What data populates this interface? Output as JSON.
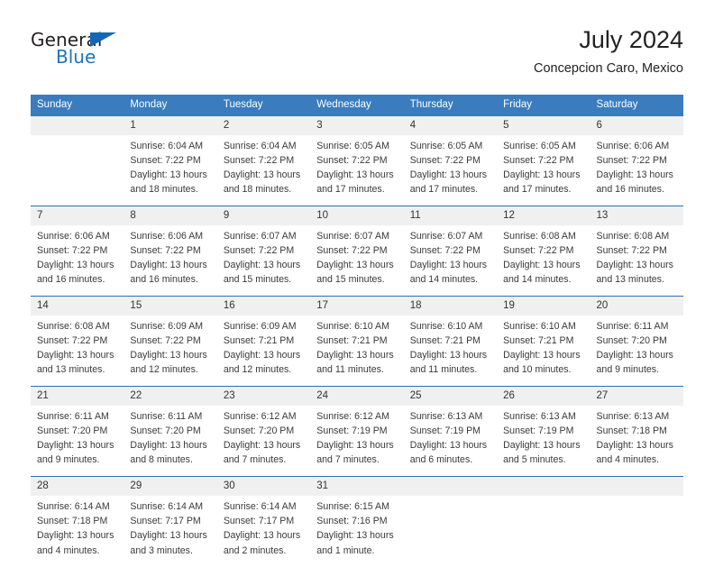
{
  "brand": {
    "name_part1": "General",
    "name_part2": "Blue",
    "triangle_icon": "triangle-icon",
    "color_black": "#231f20",
    "color_blue": "#1b75bb"
  },
  "header": {
    "title": "July 2024",
    "subtitle": "Concepcion Caro, Mexico"
  },
  "theme": {
    "header_bg": "#3a7cbe",
    "header_text": "#ffffff",
    "daynum_bg": "#f0f0f0",
    "week_divider": "#2f6fb0",
    "body_text": "#3a3a3a"
  },
  "weekday_headers": [
    "Sunday",
    "Monday",
    "Tuesday",
    "Wednesday",
    "Thursday",
    "Friday",
    "Saturday"
  ],
  "weeks": [
    {
      "days": [
        {
          "num": "",
          "sunrise": "",
          "sunset": "",
          "daylight": "",
          "empty": true
        },
        {
          "num": "1",
          "sunrise": "Sunrise: 6:04 AM",
          "sunset": "Sunset: 7:22 PM",
          "daylight": "Daylight: 13 hours and 18 minutes."
        },
        {
          "num": "2",
          "sunrise": "Sunrise: 6:04 AM",
          "sunset": "Sunset: 7:22 PM",
          "daylight": "Daylight: 13 hours and 18 minutes."
        },
        {
          "num": "3",
          "sunrise": "Sunrise: 6:05 AM",
          "sunset": "Sunset: 7:22 PM",
          "daylight": "Daylight: 13 hours and 17 minutes."
        },
        {
          "num": "4",
          "sunrise": "Sunrise: 6:05 AM",
          "sunset": "Sunset: 7:22 PM",
          "daylight": "Daylight: 13 hours and 17 minutes."
        },
        {
          "num": "5",
          "sunrise": "Sunrise: 6:05 AM",
          "sunset": "Sunset: 7:22 PM",
          "daylight": "Daylight: 13 hours and 17 minutes."
        },
        {
          "num": "6",
          "sunrise": "Sunrise: 6:06 AM",
          "sunset": "Sunset: 7:22 PM",
          "daylight": "Daylight: 13 hours and 16 minutes."
        }
      ]
    },
    {
      "days": [
        {
          "num": "7",
          "sunrise": "Sunrise: 6:06 AM",
          "sunset": "Sunset: 7:22 PM",
          "daylight": "Daylight: 13 hours and 16 minutes."
        },
        {
          "num": "8",
          "sunrise": "Sunrise: 6:06 AM",
          "sunset": "Sunset: 7:22 PM",
          "daylight": "Daylight: 13 hours and 16 minutes."
        },
        {
          "num": "9",
          "sunrise": "Sunrise: 6:07 AM",
          "sunset": "Sunset: 7:22 PM",
          "daylight": "Daylight: 13 hours and 15 minutes."
        },
        {
          "num": "10",
          "sunrise": "Sunrise: 6:07 AM",
          "sunset": "Sunset: 7:22 PM",
          "daylight": "Daylight: 13 hours and 15 minutes."
        },
        {
          "num": "11",
          "sunrise": "Sunrise: 6:07 AM",
          "sunset": "Sunset: 7:22 PM",
          "daylight": "Daylight: 13 hours and 14 minutes."
        },
        {
          "num": "12",
          "sunrise": "Sunrise: 6:08 AM",
          "sunset": "Sunset: 7:22 PM",
          "daylight": "Daylight: 13 hours and 14 minutes."
        },
        {
          "num": "13",
          "sunrise": "Sunrise: 6:08 AM",
          "sunset": "Sunset: 7:22 PM",
          "daylight": "Daylight: 13 hours and 13 minutes."
        }
      ]
    },
    {
      "days": [
        {
          "num": "14",
          "sunrise": "Sunrise: 6:08 AM",
          "sunset": "Sunset: 7:22 PM",
          "daylight": "Daylight: 13 hours and 13 minutes."
        },
        {
          "num": "15",
          "sunrise": "Sunrise: 6:09 AM",
          "sunset": "Sunset: 7:22 PM",
          "daylight": "Daylight: 13 hours and 12 minutes."
        },
        {
          "num": "16",
          "sunrise": "Sunrise: 6:09 AM",
          "sunset": "Sunset: 7:21 PM",
          "daylight": "Daylight: 13 hours and 12 minutes."
        },
        {
          "num": "17",
          "sunrise": "Sunrise: 6:10 AM",
          "sunset": "Sunset: 7:21 PM",
          "daylight": "Daylight: 13 hours and 11 minutes."
        },
        {
          "num": "18",
          "sunrise": "Sunrise: 6:10 AM",
          "sunset": "Sunset: 7:21 PM",
          "daylight": "Daylight: 13 hours and 11 minutes."
        },
        {
          "num": "19",
          "sunrise": "Sunrise: 6:10 AM",
          "sunset": "Sunset: 7:21 PM",
          "daylight": "Daylight: 13 hours and 10 minutes."
        },
        {
          "num": "20",
          "sunrise": "Sunrise: 6:11 AM",
          "sunset": "Sunset: 7:20 PM",
          "daylight": "Daylight: 13 hours and 9 minutes."
        }
      ]
    },
    {
      "days": [
        {
          "num": "21",
          "sunrise": "Sunrise: 6:11 AM",
          "sunset": "Sunset: 7:20 PM",
          "daylight": "Daylight: 13 hours and 9 minutes."
        },
        {
          "num": "22",
          "sunrise": "Sunrise: 6:11 AM",
          "sunset": "Sunset: 7:20 PM",
          "daylight": "Daylight: 13 hours and 8 minutes."
        },
        {
          "num": "23",
          "sunrise": "Sunrise: 6:12 AM",
          "sunset": "Sunset: 7:20 PM",
          "daylight": "Daylight: 13 hours and 7 minutes."
        },
        {
          "num": "24",
          "sunrise": "Sunrise: 6:12 AM",
          "sunset": "Sunset: 7:19 PM",
          "daylight": "Daylight: 13 hours and 7 minutes."
        },
        {
          "num": "25",
          "sunrise": "Sunrise: 6:13 AM",
          "sunset": "Sunset: 7:19 PM",
          "daylight": "Daylight: 13 hours and 6 minutes."
        },
        {
          "num": "26",
          "sunrise": "Sunrise: 6:13 AM",
          "sunset": "Sunset: 7:19 PM",
          "daylight": "Daylight: 13 hours and 5 minutes."
        },
        {
          "num": "27",
          "sunrise": "Sunrise: 6:13 AM",
          "sunset": "Sunset: 7:18 PM",
          "daylight": "Daylight: 13 hours and 4 minutes."
        }
      ]
    },
    {
      "days": [
        {
          "num": "28",
          "sunrise": "Sunrise: 6:14 AM",
          "sunset": "Sunset: 7:18 PM",
          "daylight": "Daylight: 13 hours and 4 minutes."
        },
        {
          "num": "29",
          "sunrise": "Sunrise: 6:14 AM",
          "sunset": "Sunset: 7:17 PM",
          "daylight": "Daylight: 13 hours and 3 minutes."
        },
        {
          "num": "30",
          "sunrise": "Sunrise: 6:14 AM",
          "sunset": "Sunset: 7:17 PM",
          "daylight": "Daylight: 13 hours and 2 minutes."
        },
        {
          "num": "31",
          "sunrise": "Sunrise: 6:15 AM",
          "sunset": "Sunset: 7:16 PM",
          "daylight": "Daylight: 13 hours and 1 minute."
        },
        {
          "num": "",
          "sunrise": "",
          "sunset": "",
          "daylight": "",
          "empty": true
        },
        {
          "num": "",
          "sunrise": "",
          "sunset": "",
          "daylight": "",
          "empty": true
        },
        {
          "num": "",
          "sunrise": "",
          "sunset": "",
          "daylight": "",
          "empty": true
        }
      ]
    }
  ]
}
